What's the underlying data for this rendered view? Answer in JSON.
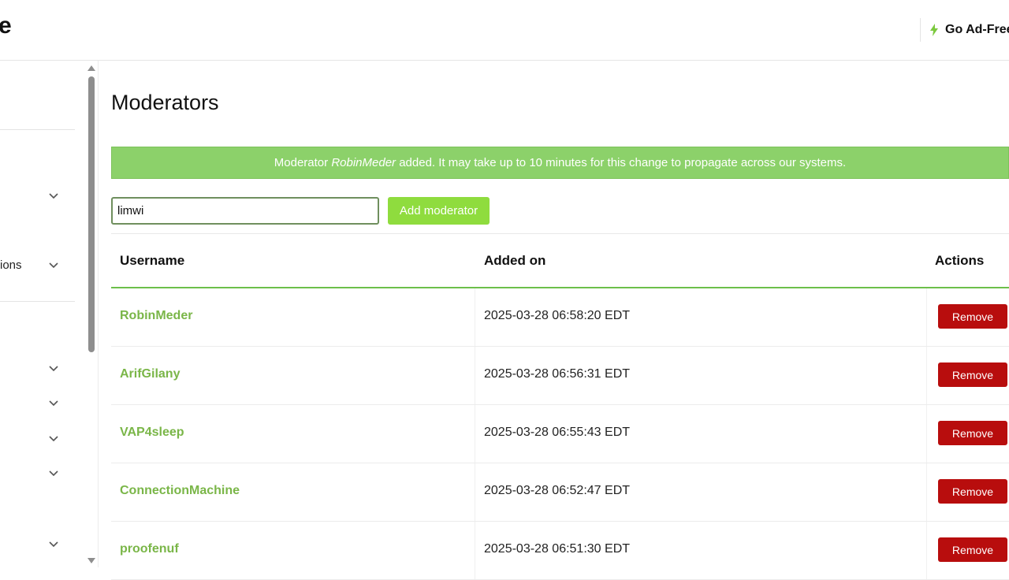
{
  "header": {
    "logo_fragment": "e",
    "go_adfree_label": "Go Ad-Free"
  },
  "sidebar": {
    "partial_label": "ions"
  },
  "page": {
    "title": "Moderators"
  },
  "alert": {
    "prefix": "Moderator ",
    "username": "RobinMeder",
    "suffix": " added. It may take up to 10 minutes for this change to propagate across our systems."
  },
  "add_form": {
    "input_value": "limwi",
    "button_label": "Add moderator"
  },
  "table": {
    "headers": {
      "username": "Username",
      "added_on": "Added on",
      "actions": "Actions"
    },
    "rows": [
      {
        "username": "RobinMeder",
        "added_on": "2025-03-28 06:58:20 EDT",
        "action": "Remove"
      },
      {
        "username": "ArifGilany",
        "added_on": "2025-03-28 06:56:31 EDT",
        "action": "Remove"
      },
      {
        "username": "VAP4sleep",
        "added_on": "2025-03-28 06:55:43 EDT",
        "action": "Remove"
      },
      {
        "username": "ConnectionMachine",
        "added_on": "2025-03-28 06:52:47 EDT",
        "action": "Remove"
      },
      {
        "username": "proofenuf",
        "added_on": "2025-03-28 06:51:30 EDT",
        "action": "Remove"
      }
    ]
  },
  "colors": {
    "accent_green": "#8fdc3e",
    "alert_green": "#8cd16a",
    "username_green": "#7ab648",
    "remove_red": "#b80d0d"
  },
  "icons": [
    "bolt-icon",
    "chevron-down-icon",
    "scroll-up-arrow-icon",
    "scroll-down-arrow-icon"
  ]
}
